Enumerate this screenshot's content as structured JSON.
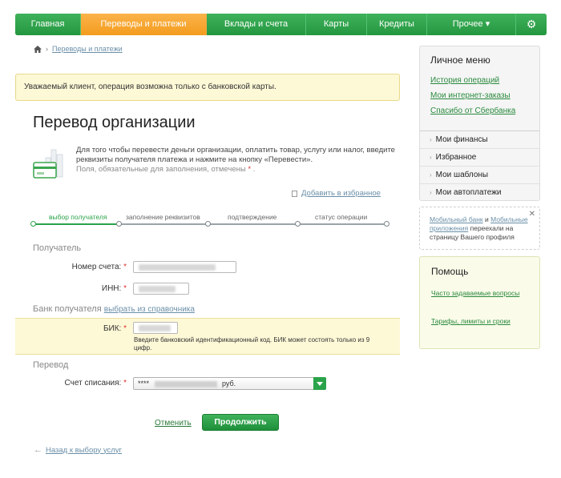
{
  "nav": {
    "items": [
      {
        "label": "Главная",
        "active": false
      },
      {
        "label": "Переводы и платежи",
        "active": true
      },
      {
        "label": "Вклады и счета",
        "active": false
      },
      {
        "label": "Карты",
        "active": false
      },
      {
        "label": "Кредиты",
        "active": false
      },
      {
        "label": "Прочее ▾",
        "active": false
      }
    ],
    "settings_icon": "gear-icon"
  },
  "breadcrumb": {
    "home_icon": "home-icon",
    "link": "Переводы и платежи"
  },
  "warning": "Уважаемый клиент, операция возможна только с банковской карты.",
  "page_title": "Перевод организации",
  "intro": {
    "text": "Для того чтобы перевести деньги организации, оплатить товар, услугу или налог, введите реквизиты получателя платежа и нажмите на кнопку «Перевести».",
    "required_note": "Поля, обязательные для заполнения, отмечены",
    "star": "*"
  },
  "add_favorite": "Добавить в избранное",
  "steps": [
    {
      "label": "выбор получателя",
      "active": true
    },
    {
      "label": "заполнение реквизитов",
      "active": false
    },
    {
      "label": "подтверждение",
      "active": false
    },
    {
      "label": "статус операции",
      "active": false
    }
  ],
  "form": {
    "recipient_section": "Получатель",
    "account_label": "Номер счета:",
    "inn_label": "ИНН:",
    "bank_section": "Банк получателя",
    "choose_from_directory": "выбрать из справочника",
    "bik_label": "БИК:",
    "bik_hint": "Введите банковский идентификационный код. БИК может состоять только из 9 цифр.",
    "transfer_section": "Перевод",
    "debit_account_label": "Счет списания:",
    "debit_account_prefix": "****",
    "debit_account_currency": "руб.",
    "star": "*"
  },
  "actions": {
    "cancel": "Отменить",
    "continue": "Продолжить",
    "back": "Назад к выбору услуг"
  },
  "personal_menu": {
    "title": "Личное меню",
    "links": [
      "История операций",
      "Мои интернет-заказы",
      "Спасибо от Сбербанка"
    ],
    "sections": [
      "Мои финансы",
      "Избранное",
      "Мои шаблоны",
      "Мои автоплатежи"
    ]
  },
  "notice": {
    "link1": "Мобильный банк",
    "and": "и",
    "link2": "Мобильные приложения",
    "rest": "переехали на страницу Вашего профиля"
  },
  "help": {
    "title": "Помощь",
    "links": [
      "Часто задаваемые вопросы",
      "Тарифы, лимиты и сроки"
    ]
  },
  "colors": {
    "brand_green": "#2aa34a",
    "active_tab_orange": "#f5a52c",
    "warning_bg": "#fdf8d6"
  }
}
